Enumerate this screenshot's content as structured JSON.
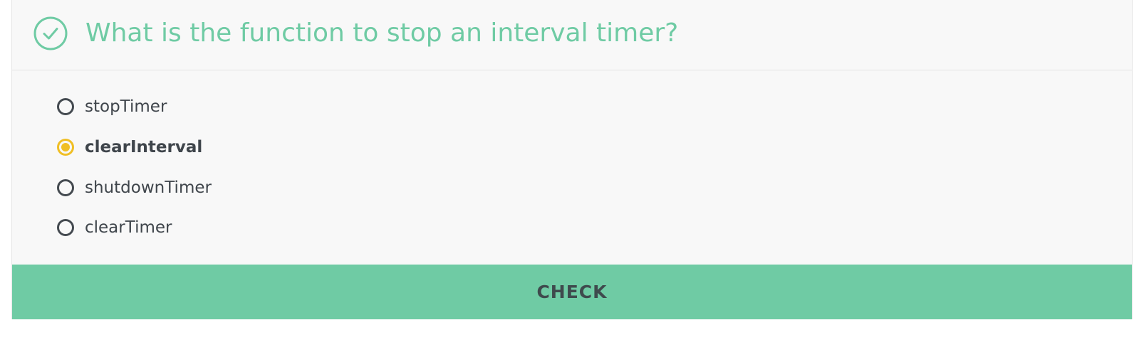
{
  "quiz": {
    "status_icon": "check-circle-icon",
    "question": "What is the function to stop an interval timer?",
    "options": [
      {
        "label": "stopTimer",
        "selected": false
      },
      {
        "label": "clearInterval",
        "selected": true
      },
      {
        "label": "shutdownTimer",
        "selected": false
      },
      {
        "label": "clearTimer",
        "selected": false
      }
    ],
    "check_label": "CHECK"
  },
  "colors": {
    "accent_green": "#6fcba4",
    "selected_yellow": "#f0bf25",
    "text_dark": "#3f454b",
    "card_background": "#f8f8f8"
  }
}
